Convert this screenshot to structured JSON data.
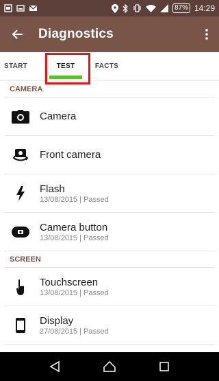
{
  "status_bar": {
    "battery": "87%",
    "time": "14:29"
  },
  "app_bar": {
    "title": "Diagnostics"
  },
  "tabs": [
    {
      "label": "START"
    },
    {
      "label": "TEST"
    },
    {
      "label": "FACTS"
    }
  ],
  "sections": {
    "camera": {
      "header": "CAMERA",
      "items": [
        {
          "title": "Camera",
          "icon": "camera-icon"
        },
        {
          "title": "Front camera",
          "icon": "front-camera-icon"
        },
        {
          "title": "Flash",
          "subtitle": "13/08/2015 | Passed",
          "icon": "flash-icon"
        },
        {
          "title": "Camera button",
          "subtitle": "13/08/2015 | Passed",
          "icon": "camera-button-icon"
        }
      ]
    },
    "screen": {
      "header": "SCREEN",
      "items": [
        {
          "title": "Touchscreen",
          "subtitle": "13/08/2015 | Passed",
          "icon": "touch-icon"
        },
        {
          "title": "Display",
          "subtitle": "27/08/2015 | Passed",
          "icon": "display-icon"
        }
      ]
    }
  },
  "colors": {
    "status_bar": "#5b3f38",
    "app_bar": "#795548",
    "tab_indicator": "#5ac12c",
    "highlight_box": "#ee1111",
    "section_header": "#795548"
  }
}
